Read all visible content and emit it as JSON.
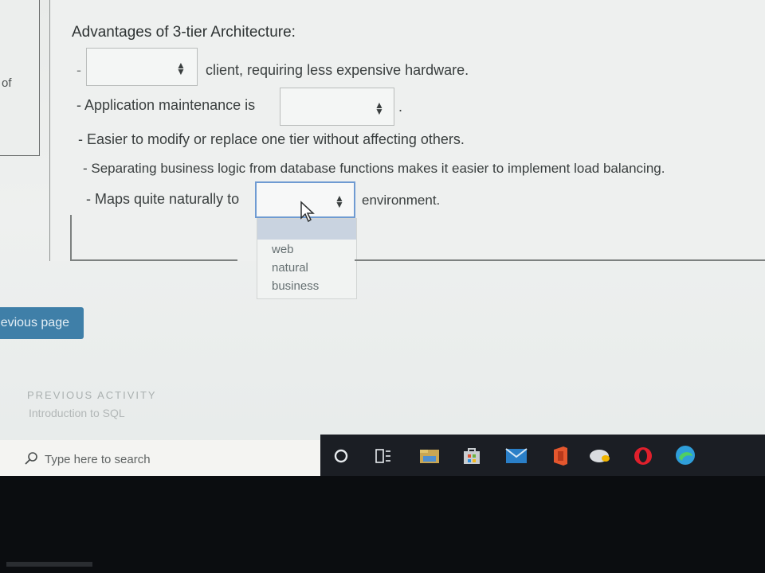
{
  "question": {
    "heading": "Advantages of 3-tier Architecture:",
    "rows": [
      {
        "prefix": "-",
        "suffix": "client, requiring less expensive hardware."
      },
      {
        "prefix": "- Application maintenance is",
        "suffix": "."
      },
      {
        "text": "- Easier to modify or replace one tier without affecting others."
      },
      {
        "text": "- Separating business logic from database functions makes it easier to implement load balancing."
      },
      {
        "prefix": "- Maps quite naturally to",
        "suffix": "environment."
      }
    ],
    "dropdown_options": [
      "web",
      "natural",
      "business"
    ]
  },
  "left_card": {
    "fragment": "of"
  },
  "nav": {
    "prev_button": "evious page",
    "prev_activity_label": "PREVIOUS ACTIVITY",
    "prev_activity_title": "Introduction to SQL"
  },
  "taskbar": {
    "search_placeholder": "Type here to search",
    "icons": [
      "search-icon",
      "cortana-icon",
      "task-view-icon",
      "file-explorer-icon",
      "store-icon",
      "mail-icon",
      "office-icon",
      "app-icon",
      "opera-icon",
      "edge-icon"
    ]
  },
  "colors": {
    "prev_button": "#3f7fa8",
    "taskbar": "#1b1e24",
    "active_select_border": "#6f9bd2"
  }
}
